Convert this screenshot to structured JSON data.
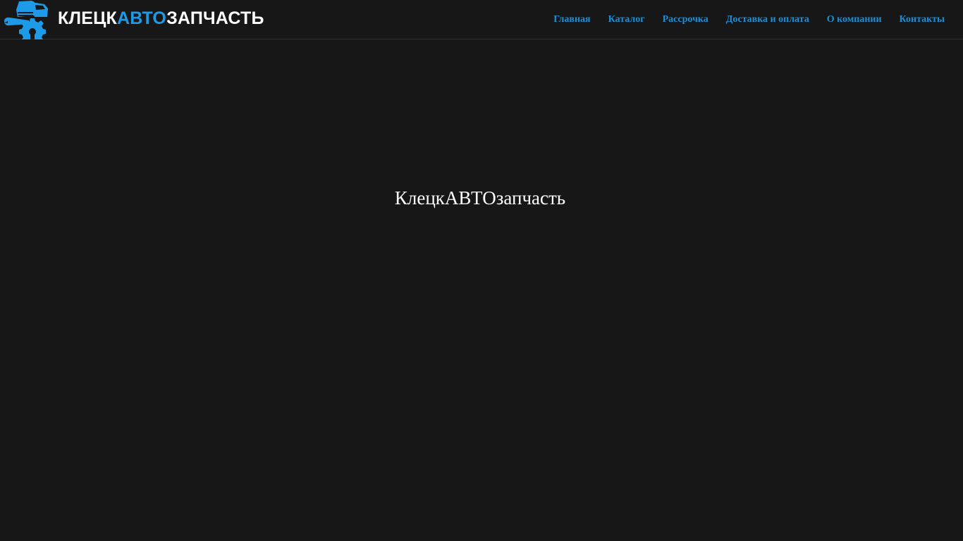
{
  "header": {
    "logo": {
      "part1": "КЛЕЦК",
      "part2": "АВТО",
      "part3": "ЗАПЧАСТЬ",
      "icon": "truck-gear-wrench-icon",
      "accent_color": "#1e9be8"
    },
    "nav": {
      "items": [
        {
          "label": "Главная"
        },
        {
          "label": "Каталог"
        },
        {
          "label": "Рассрочка"
        },
        {
          "label": "Доставка и оплата"
        },
        {
          "label": "О компании"
        },
        {
          "label": "Контакты"
        }
      ],
      "link_color": "#1e8fd6"
    }
  },
  "main": {
    "title": "КлецкАВТОзапчасть"
  },
  "colors": {
    "background": "#171717",
    "text": "#ffffff"
  }
}
